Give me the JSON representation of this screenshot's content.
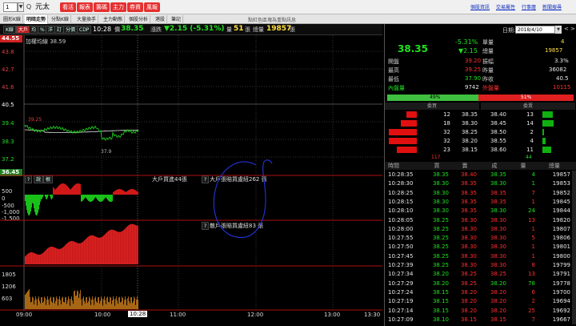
{
  "toolbar": {
    "symbol_input": "1",
    "zoom": "Q",
    "name": "元太",
    "buttons": [
      "看活",
      "報表",
      "籌碼",
      "主力",
      "券資",
      "風報"
    ],
    "right_links": [
      "個股資訊",
      "交易屬性",
      "行事曆",
      "新聞搜尋"
    ]
  },
  "tabs": [
    "圖形K線",
    "明暗走勢",
    "分點K線",
    "大量換手",
    "主力動態",
    "個股分析",
    "港股",
    "筆記"
  ],
  "tabs_hint": "點紅色區塊為重點訊息",
  "active_tab": 1,
  "chart_tools": [
    "K線",
    "大戶",
    "均",
    "%",
    "洋",
    "訂",
    "分價",
    "CDP"
  ],
  "time": "10:28",
  "price_label": "價",
  "price": "38.35",
  "change_label": "漲跌",
  "change": "▼2.15 (-5.31%)",
  "vol_label": "量",
  "vol": "51",
  "vol_unit": "張",
  "total_label": "總量",
  "total": "19857",
  "total_unit": "張",
  "price_axis": {
    "top": "44.55",
    "labels": [
      "43.8",
      "42.7",
      "41.6",
      "40.5",
      "39.4",
      "38.3",
      "37.2"
    ],
    "bottom": "36.45"
  },
  "avg_label": "加權均線 38.59",
  "high_mark": "39.25",
  "low_mark": "37.9",
  "panel_tools": [
    "?",
    "說",
    "根"
  ],
  "flow_axis": [
    "500",
    "0",
    "-500",
    "-1,000",
    "-1,500"
  ],
  "main_flow": "大戶買進44張",
  "main_note": "大戶張賠買盧紐262 張",
  "retail_note": "散戶張賠買盧紐83 張",
  "vol_axis": [
    "1805",
    "1206",
    "603"
  ],
  "time_axis": [
    "09:00",
    "10:00",
    "10:28",
    "11:00",
    "12:00",
    "13:00",
    "13:30"
  ],
  "cursor_time": "10:28",
  "quote": {
    "date_label": "日期:",
    "date": "2018/4/10",
    "price": "38.35",
    "pct": "-5.31%",
    "chg": "▼2.15",
    "single_label": "單量",
    "single": "4",
    "total_label": "總量",
    "total": "19857",
    "open_label": "開盤",
    "open": "39.20",
    "amp_label": "振幅",
    "amp": "3.3%",
    "high_label": "最高",
    "high": "39.25",
    "yvol_label": "昨量",
    "yvol": "36082",
    "low_label": "最低",
    "low": "37.90",
    "prev_label": "昨收",
    "prev": "40.5",
    "in_label": "內盤量",
    "in": "9742",
    "out_label": "外盤量",
    "out": "10115",
    "ratio_in": "49%",
    "ratio_out": "51%",
    "ratio_in_value": 0.49,
    "bid_label": "委買",
    "ask_label": "委賣"
  },
  "book": [
    {
      "bq": "12",
      "bp": "38.35",
      "ap": "38.40",
      "aq": "13"
    },
    {
      "bq": "18",
      "bp": "38.30",
      "ap": "38.45",
      "aq": "14"
    },
    {
      "bq": "32",
      "bp": "38.25",
      "ap": "38.50",
      "aq": "2"
    },
    {
      "bq": "32",
      "bp": "38.20",
      "ap": "38.55",
      "aq": "4"
    },
    {
      "bq": "23",
      "bp": "38.15",
      "ap": "38.60",
      "aq": "11"
    }
  ],
  "book_sum": {
    "bid": "117",
    "ask": "44"
  },
  "tick_headers": [
    "時間",
    "買",
    "賣",
    "成",
    "量",
    "總量"
  ],
  "ticks": [
    [
      "10:28:35",
      "38.35",
      "38.40",
      "38.35",
      "4",
      "19857"
    ],
    [
      "10:28:30",
      "38.30",
      "38.35",
      "38.30",
      "1",
      "19853"
    ],
    [
      "10:28:25",
      "38.30",
      "38.35",
      "38.35",
      "7",
      "19852"
    ],
    [
      "10:28:15",
      "38.30",
      "38.35",
      "38.35",
      "1",
      "19845"
    ],
    [
      "10:28:10",
      "38.30",
      "38.35",
      "38.30",
      "24",
      "19844"
    ],
    [
      "10:28:05",
      "38.25",
      "38.30",
      "38.30",
      "13",
      "19820"
    ],
    [
      "10:28:00",
      "38.25",
      "38.30",
      "38.30",
      "1",
      "19807"
    ],
    [
      "10:27:55",
      "38.25",
      "38.30",
      "38.30",
      "5",
      "19806"
    ],
    [
      "10:27:50",
      "38.25",
      "38.30",
      "38.30",
      "1",
      "19801"
    ],
    [
      "10:27:45",
      "38.25",
      "38.30",
      "38.30",
      "1",
      "19800"
    ],
    [
      "10:27:39",
      "38.25",
      "38.30",
      "38.30",
      "8",
      "19799"
    ],
    [
      "10:27:34",
      "38.20",
      "38.25",
      "38.25",
      "13",
      "19791"
    ],
    [
      "10:27:29",
      "38.20",
      "38.25",
      "38.20",
      "78",
      "19778"
    ],
    [
      "10:27:24",
      "38.15",
      "38.20",
      "38.20",
      "6",
      "19700"
    ],
    [
      "10:27:19",
      "38.15",
      "38.20",
      "38.20",
      "2",
      "19694"
    ],
    [
      "10:27:14",
      "38.15",
      "38.20",
      "38.20",
      "25",
      "19692"
    ],
    [
      "10:27:09",
      "38.10",
      "38.15",
      "38.15",
      "7",
      "19667"
    ]
  ]
}
